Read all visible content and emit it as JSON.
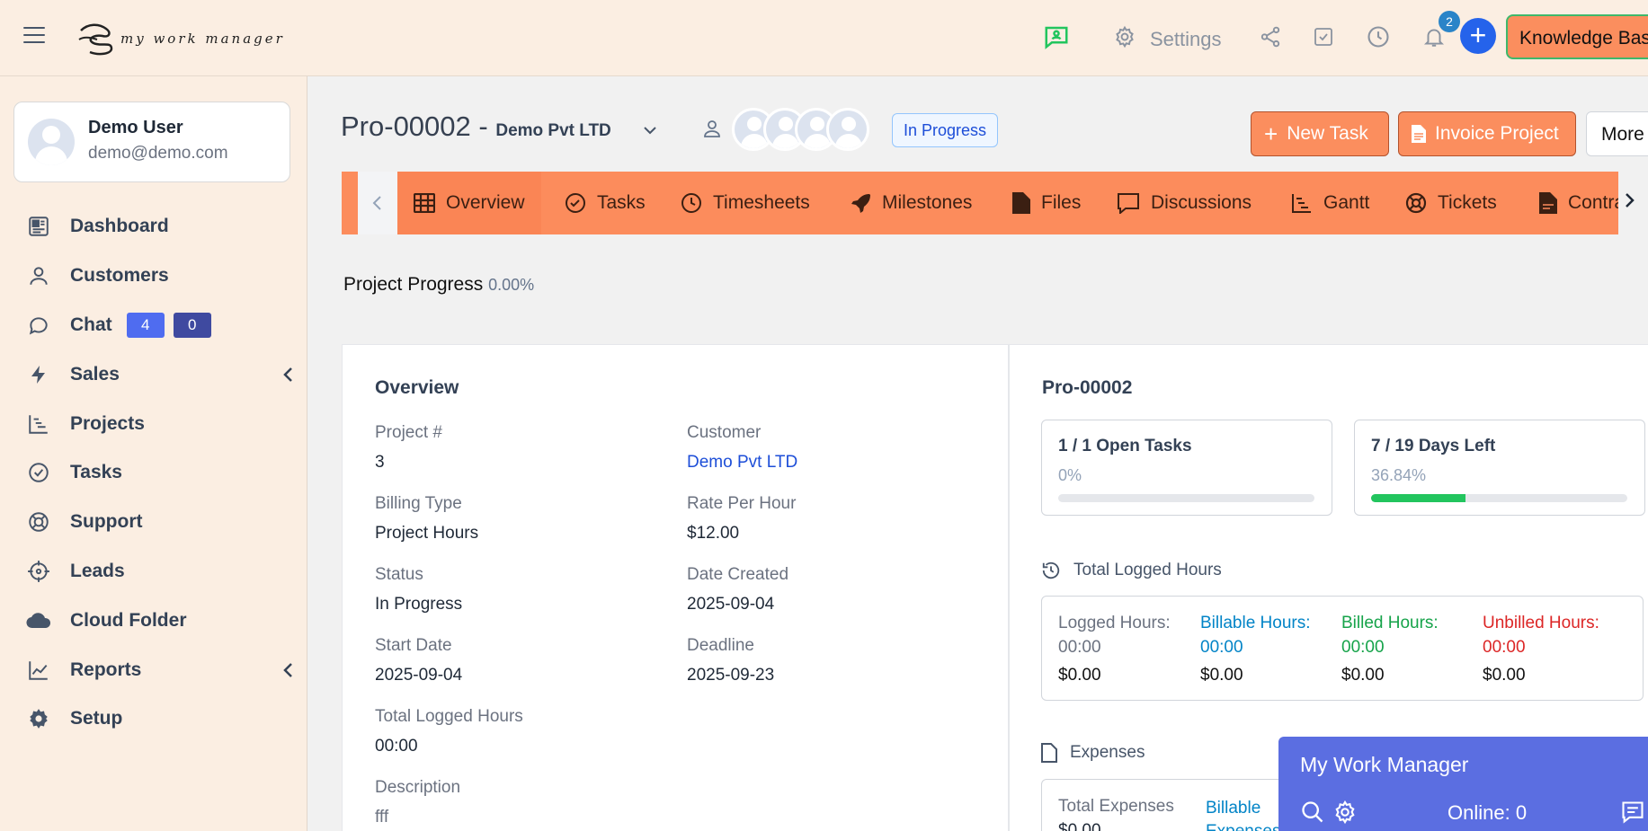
{
  "app": {
    "logo_text": "my work manager"
  },
  "topbar": {
    "settings_label": "Settings",
    "notification_count": "2",
    "add_label": "+",
    "knowledge_base_label": "Knowledge Base",
    "icons": [
      "chat-support-icon",
      "gear-icon",
      "share-icon",
      "checkbox-icon",
      "clock-icon",
      "bell-icon"
    ]
  },
  "user": {
    "name": "Demo User",
    "email": "demo@demo.com"
  },
  "sidebar": {
    "items": [
      {
        "label": "Dashboard",
        "icon": "dashboard-icon"
      },
      {
        "label": "Customers",
        "icon": "user-icon"
      },
      {
        "label": "Chat",
        "icon": "chat-icon",
        "badge_a": "4",
        "badge_b": "0"
      },
      {
        "label": "Sales",
        "icon": "bolt-icon",
        "submenu": true
      },
      {
        "label": "Projects",
        "icon": "gantt-icon"
      },
      {
        "label": "Tasks",
        "icon": "check-circle-icon"
      },
      {
        "label": "Support",
        "icon": "lifebuoy-icon"
      },
      {
        "label": "Leads",
        "icon": "crosshair-icon"
      },
      {
        "label": "Cloud Folder",
        "icon": "cloud-icon"
      },
      {
        "label": "Reports",
        "icon": "chart-line-icon",
        "submenu": true
      },
      {
        "label": "Setup",
        "icon": "gear-icon"
      }
    ],
    "badge_colors": {
      "a": "#4f6cf0",
      "b": "#3f4aa0"
    }
  },
  "project": {
    "code": "Pro-00002",
    "separator": " - ",
    "customer": "Demo Pvt LTD",
    "status": "In Progress",
    "new_task_label": "New Task",
    "invoice_label": "Invoice Project",
    "more_label": "More",
    "progress_label": "Project Progress",
    "progress_value": "0.00%"
  },
  "tabs": [
    {
      "label": "Overview",
      "icon": "grid-icon",
      "active": true
    },
    {
      "label": "Tasks",
      "icon": "check-circle-icon"
    },
    {
      "label": "Timesheets",
      "icon": "clock-icon"
    },
    {
      "label": "Milestones",
      "icon": "rocket-icon"
    },
    {
      "label": "Files",
      "icon": "file-icon"
    },
    {
      "label": "Discussions",
      "icon": "comment-icon"
    },
    {
      "label": "Gantt",
      "icon": "gantt-icon"
    },
    {
      "label": "Tickets",
      "icon": "lifebuoy-icon"
    },
    {
      "label": "Contracts",
      "icon": "contract-icon"
    }
  ],
  "overview": {
    "title": "Overview",
    "fields": {
      "project_no": {
        "label": "Project #",
        "value": "3"
      },
      "customer": {
        "label": "Customer",
        "value": "Demo Pvt LTD"
      },
      "billing_type": {
        "label": "Billing Type",
        "value": "Project Hours"
      },
      "rate": {
        "label": "Rate Per Hour",
        "value": "$12.00"
      },
      "status": {
        "label": "Status",
        "value": "In Progress"
      },
      "date_created": {
        "label": "Date Created",
        "value": "2025-09-04"
      },
      "start_date": {
        "label": "Start Date",
        "value": "2025-09-04"
      },
      "deadline": {
        "label": "Deadline",
        "value": "2025-09-23"
      },
      "total_logged": {
        "label": "Total Logged Hours",
        "value": "00:00"
      },
      "description": {
        "label": "Description",
        "value": "fff"
      }
    }
  },
  "summary": {
    "title": "Pro-00002",
    "open_tasks": {
      "title": "1 / 1 Open Tasks",
      "percent_text": "0%",
      "fill": 0
    },
    "days_left": {
      "title": "7 / 19 Days Left",
      "percent_text": "36.84%",
      "fill": 0.3684
    },
    "logged_hours_heading": "Total Logged Hours",
    "hours": [
      {
        "label": "Logged Hours:",
        "time": "00:00",
        "amount": "$0.00",
        "color": "#6b7280"
      },
      {
        "label": "Billable Hours:",
        "time": "00:00",
        "amount": "$0.00",
        "color": "#0284c7"
      },
      {
        "label": "Billed Hours:",
        "time": "00:00",
        "amount": "$0.00",
        "color": "#16a34a"
      },
      {
        "label": "Unbilled Hours:",
        "time": "00:00",
        "amount": "$0.00",
        "color": "#dc2626"
      }
    ],
    "expenses_heading": "Expenses",
    "total_expenses_label": "Total Expenses",
    "total_expenses_value": "$0.00",
    "billable_expenses_label": "Billable Expenses"
  },
  "chat_widget": {
    "title": "My Work Manager",
    "online": "Online: 0"
  }
}
